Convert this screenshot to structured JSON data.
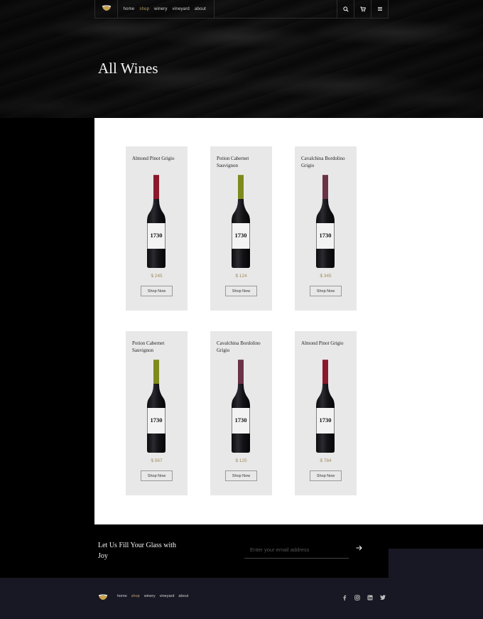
{
  "nav": {
    "links": [
      "home",
      "shop",
      "winery",
      "vineyard",
      "about"
    ],
    "active": "shop",
    "icons": [
      "search-icon",
      "cart-icon",
      "menu-icon"
    ]
  },
  "hero": {
    "title": "All Wines"
  },
  "products": [
    {
      "name": "Almond Pinot Grigio",
      "price": "$ 245",
      "button": "Shop Now",
      "capsule_color": "#8a1a2c",
      "label": "1730"
    },
    {
      "name": "Potion Cabernet Sauvignon",
      "price": "$ 124",
      "button": "Shop Now",
      "capsule_color": "#7d8a1c",
      "label": "1730"
    },
    {
      "name": "Cavalchina Bordolino Grigio",
      "price": "$ 345",
      "button": "Shop Now",
      "capsule_color": "#6a3347",
      "label": "1730"
    },
    {
      "name": "Potion Cabernet Sauvignon",
      "price": "$ 567",
      "button": "Shop Now",
      "capsule_color": "#7d8a1c",
      "label": "1730"
    },
    {
      "name": "Cavalchina Bordolino Grigio",
      "price": "$ 125",
      "button": "Shop Now",
      "capsule_color": "#6a3347",
      "label": "1730"
    },
    {
      "name": "Almond Pinot Grigio",
      "price": "$ 784",
      "button": "Shop Now",
      "capsule_color": "#8a1a2c",
      "label": "1730"
    }
  ],
  "newsletter": {
    "title": "Let Us Fill Your Glass with Joy",
    "placeholder": "Enter your email address",
    "submit_icon": "arrow-right-icon"
  },
  "footer": {
    "links": [
      "home",
      "shop",
      "winery",
      "vineyard",
      "about"
    ],
    "active": "shop",
    "social": [
      "facebook-icon",
      "instagram-icon",
      "linkedin-icon",
      "twitter-icon"
    ]
  },
  "colors": {
    "accent": "#b9a06a",
    "footer_bg": "#181824",
    "card_bg": "#e8e8e8"
  }
}
